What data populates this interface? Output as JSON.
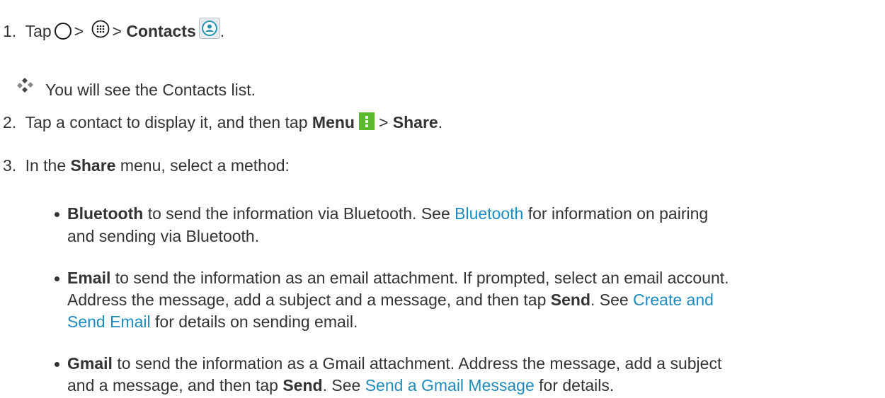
{
  "step1": {
    "num": "1.",
    "tap": "Tap",
    "sep1": ">",
    "sep2": ">",
    "contacts": "Contacts",
    "end": "."
  },
  "note": {
    "text": "You will see the Contacts list."
  },
  "step2": {
    "num": "2.",
    "pre": "Tap a contact to display it, and then tap",
    "menu": "Menu",
    "sep": ">",
    "share": "Share",
    "end": "."
  },
  "step3": {
    "num": "3.",
    "pre": "In the",
    "share": "Share",
    "post": "menu, select a method:"
  },
  "bullets": [
    {
      "bold": "Bluetooth",
      "line1_a": "to send the information via Bluetooth. See",
      "line1_link": "Bluetooth",
      "line1_b": "for information on pairing",
      "line2": "and sending via Bluetooth."
    },
    {
      "bold": "Email",
      "line1": "to send the information as an email attachment. If prompted, select an email account.",
      "line2_a": "Address the message, add a subject and a message, and then tap",
      "line2_bold": "Send",
      "line2_b": ". See",
      "line2_link": "Create and",
      "line3_link": "Send Email",
      "line3_b": "for details on sending email."
    },
    {
      "bold": "Gmail",
      "line1": "to send the information as a Gmail attachment. Address the message, add a subject",
      "line2_a": "and a message, and then tap",
      "line2_bold": "Send",
      "line2_b": ". See",
      "line2_link": "Send a Gmail Message",
      "line2_c": "for details."
    }
  ],
  "colors": {
    "link": "#1f8bbd",
    "menu_icon": "#58b92a",
    "text": "#333333"
  },
  "icons": [
    "home-circle-icon",
    "apps-icon",
    "contacts-app-icon",
    "diamond-bullet-icon",
    "menu-icon"
  ]
}
